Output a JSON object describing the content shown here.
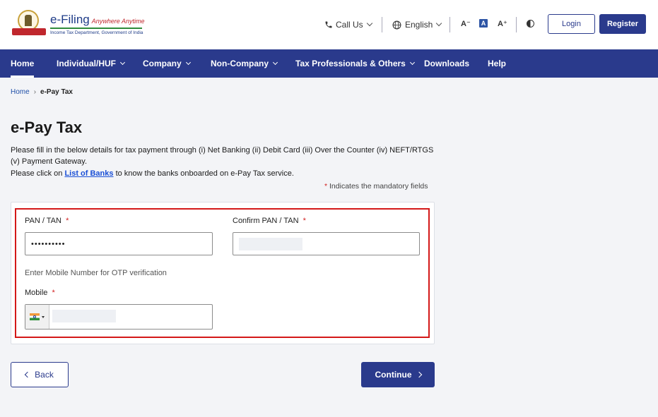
{
  "header": {
    "logo_title": "e-Filing",
    "logo_tagline": "Anywhere Anytime",
    "logo_subtitle": "Income Tax Department, Government of India",
    "call_us": "Call Us",
    "language": "English",
    "font_decrease": "A⁻",
    "font_normal": "A",
    "font_increase": "A⁺",
    "login_label": "Login",
    "register_label": "Register",
    "icons": [
      "phone-icon",
      "globe-icon",
      "contrast-icon",
      "chevron-down-icon"
    ]
  },
  "nav": {
    "items": [
      {
        "label": "Home",
        "active": true
      },
      {
        "label": "Individual/HUF"
      },
      {
        "label": "Company"
      },
      {
        "label": "Non-Company"
      },
      {
        "label": "Tax Professionals & Others"
      },
      {
        "label": "Downloads"
      },
      {
        "label": "Help"
      }
    ]
  },
  "breadcrumb": {
    "home": "Home",
    "separator": "›",
    "current": "e-Pay Tax"
  },
  "main": {
    "title": "e-Pay Tax",
    "description": "Please fill in the below details for tax payment through (i) Net Banking (ii) Debit Card (iii) Over the Counter (iv) NEFT/RTGS (v) Payment Gateway.",
    "banks_prefix": "Please click on ",
    "banks_link": "List of Banks",
    "banks_suffix": " to know the banks onboarded on e-Pay Tax service.",
    "mandatory_star": "*",
    "mandatory_text": " Indicates the mandatory fields"
  },
  "form": {
    "pan_label": "PAN / TAN",
    "pan_value": "••••••••••",
    "confirm_pan_label": "Confirm PAN / TAN",
    "otp_hint": "Enter Mobile Number for OTP verification",
    "mobile_label": "Mobile",
    "required_star": "*"
  },
  "actions": {
    "back_label": "Back",
    "continue_label": "Continue"
  },
  "colors": {
    "brand_navy": "#2a3a8c",
    "highlight_red": "#d41818",
    "link_blue": "#1a4fd6"
  }
}
